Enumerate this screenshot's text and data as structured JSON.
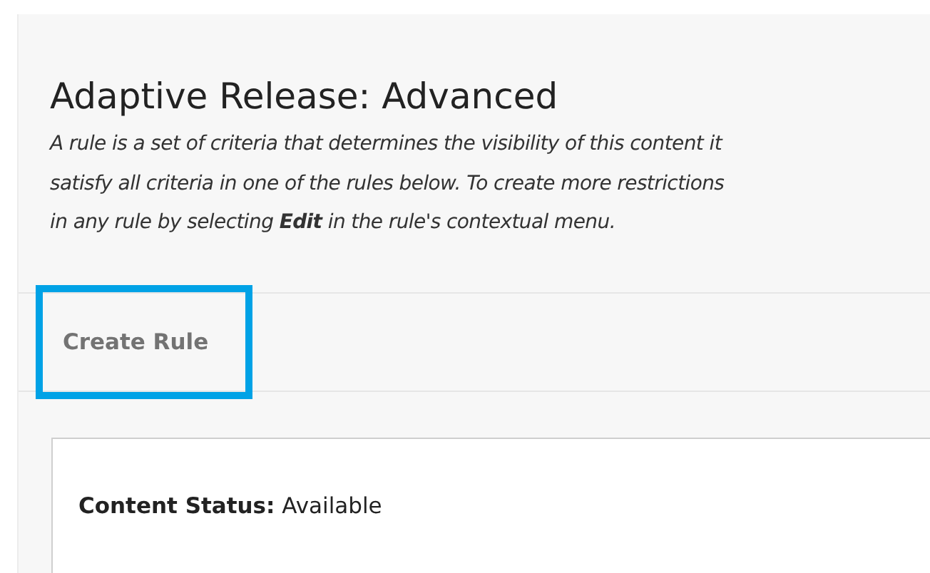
{
  "page": {
    "title": "Adaptive Release: Advanced",
    "description_lines": [
      "A rule is a set of criteria that determines the visibility of this content it",
      "satisfy all criteria in one of the rules below. To create more restrictions",
      "in any rule by selecting **Edit** in the rule's contextual menu."
    ]
  },
  "toolbar": {
    "buttons": [
      {
        "label": "Create Rule",
        "highlighted": true
      }
    ]
  },
  "rule_card": {
    "label": "Content Status:",
    "value": "Available"
  }
}
